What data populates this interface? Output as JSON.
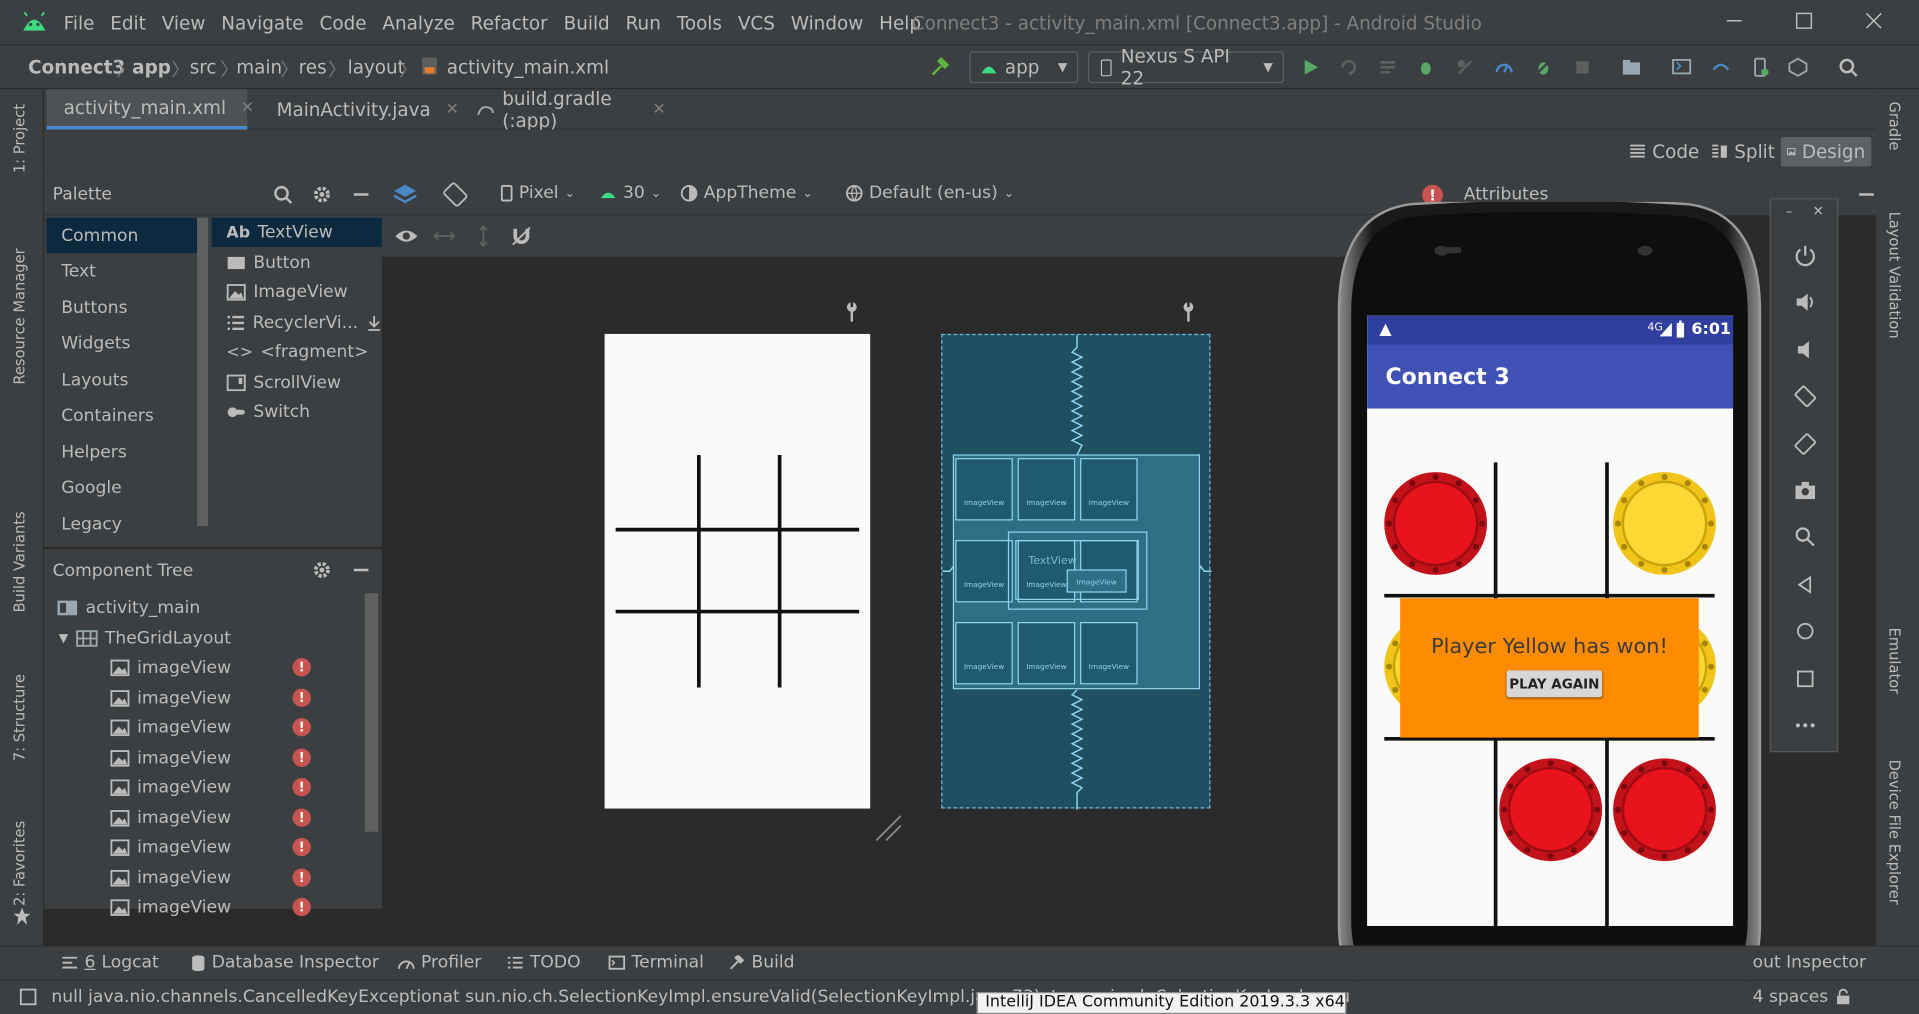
{
  "menu": [
    "File",
    "Edit",
    "View",
    "Navigate",
    "Code",
    "Analyze",
    "Refactor",
    "Build",
    "Run",
    "Tools",
    "VCS",
    "Window",
    "Help"
  ],
  "window_title": "Connect3 - activity_main.xml [Connect3.app] - Android Studio",
  "breadcrumbs": [
    "Connect3",
    "app",
    "src",
    "main",
    "res",
    "layout",
    "activity_main.xml"
  ],
  "run_config": "app",
  "device": "Nexus S API 22",
  "tabs": [
    {
      "label": "activity_main.xml",
      "active": true
    },
    {
      "label": "MainActivity.java",
      "active": false
    },
    {
      "label": "build.gradle (:app)",
      "active": false
    }
  ],
  "modes": [
    "Code",
    "Split",
    "Design"
  ],
  "selected_mode": "Design",
  "left_stripe": [
    "1: Project",
    "Resource Manager",
    "Build Variants",
    "7: Structure",
    "2: Favorites"
  ],
  "right_stripe": [
    "Gradle",
    "Layout Validation",
    "Emulator",
    "Device File Explorer"
  ],
  "palette": {
    "title": "Palette",
    "categories": [
      "Common",
      "Text",
      "Buttons",
      "Widgets",
      "Layouts",
      "Containers",
      "Helpers",
      "Google",
      "Legacy"
    ],
    "selected_category": "Common",
    "items": [
      {
        "icon": "Ab",
        "label": "TextView"
      },
      {
        "icon": "button",
        "label": "Button"
      },
      {
        "icon": "image",
        "label": "ImageView"
      },
      {
        "icon": "list",
        "label": "RecyclerVi..."
      },
      {
        "icon": "<>",
        "label": "<fragment>"
      },
      {
        "icon": "scroll",
        "label": "ScrollView"
      },
      {
        "icon": "switch",
        "label": "Switch"
      }
    ]
  },
  "component_tree": {
    "title": "Component Tree",
    "root": "activity_main",
    "grid": "TheGridLayout",
    "children": [
      "imageView",
      "imageView",
      "imageView",
      "imageView",
      "imageView",
      "imageView",
      "imageView",
      "imageView",
      "imageView"
    ]
  },
  "design_toolbar": {
    "device": "Pixel",
    "api": "30",
    "theme": "AppTheme",
    "locale": "Default (en-us)"
  },
  "blueprint_labels": {
    "image": "ImageView",
    "text": "TextView"
  },
  "attributes_title": "Attributes",
  "phone": {
    "time": "6:01",
    "signal": "4G",
    "app_title": "Connect 3",
    "win_message": "Player Yellow has won!",
    "play_again": "PLAY AGAIN"
  },
  "bottom_tools": [
    {
      "num": "6",
      "label": "Logcat"
    },
    {
      "label": "Database Inspector"
    },
    {
      "label": "Profiler"
    },
    {
      "label": "TODO"
    },
    {
      "label": "Terminal"
    },
    {
      "label": "Build"
    }
  ],
  "layout_inspector": "out Inspector",
  "status_message": "null java.nio.channels.CancelledKeyExceptionat sun.nio.ch.SelectionKeyImpl.ensureValid(SelectionKeyImpl.java:73)at sun.nio.ch.SelectionKeyImpl.ensureValid(SelectionKeyImpl.java:73)at sun.nio.ch",
  "indent": "4 spaces",
  "tooltip": "IntelliJ IDEA Community Edition 2019.3.3 x64",
  "colors": {
    "accent": "#4a88c7",
    "error": "#c75450",
    "toolbar": "#3f51b5",
    "win_box": "#ff8c00",
    "red_chip": "#e8131c",
    "yellow_chip": "#fdd835"
  }
}
